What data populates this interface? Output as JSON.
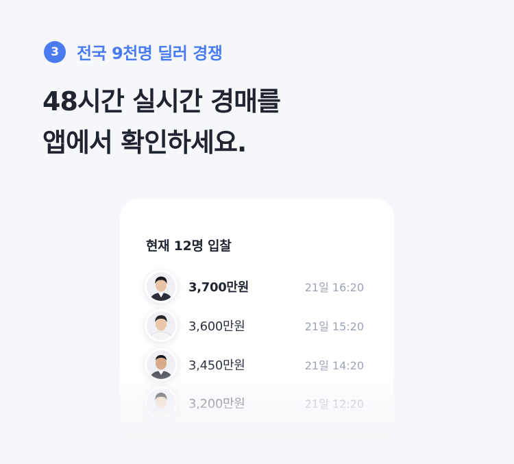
{
  "step": {
    "number": "3",
    "label": "전국 9천명 딜러 경쟁",
    "accent_color": "#4a7bf0"
  },
  "headline": {
    "line1": "48시간 실시간 경매를",
    "line2": "앱에서 확인하세요."
  },
  "card": {
    "title": "현재 12명 입찰",
    "bids": [
      {
        "amount": "3,700만원",
        "time": "21일 16:20",
        "avatar_icon": "dealer-avatar-icon"
      },
      {
        "amount": "3,600만원",
        "time": "21일 15:20",
        "avatar_icon": "dealer-avatar-icon"
      },
      {
        "amount": "3,450만원",
        "time": "21일 14:20",
        "avatar_icon": "dealer-avatar-icon"
      },
      {
        "amount": "3,200만원",
        "time": "21일 12:20",
        "avatar_icon": "dealer-avatar-icon"
      }
    ]
  }
}
